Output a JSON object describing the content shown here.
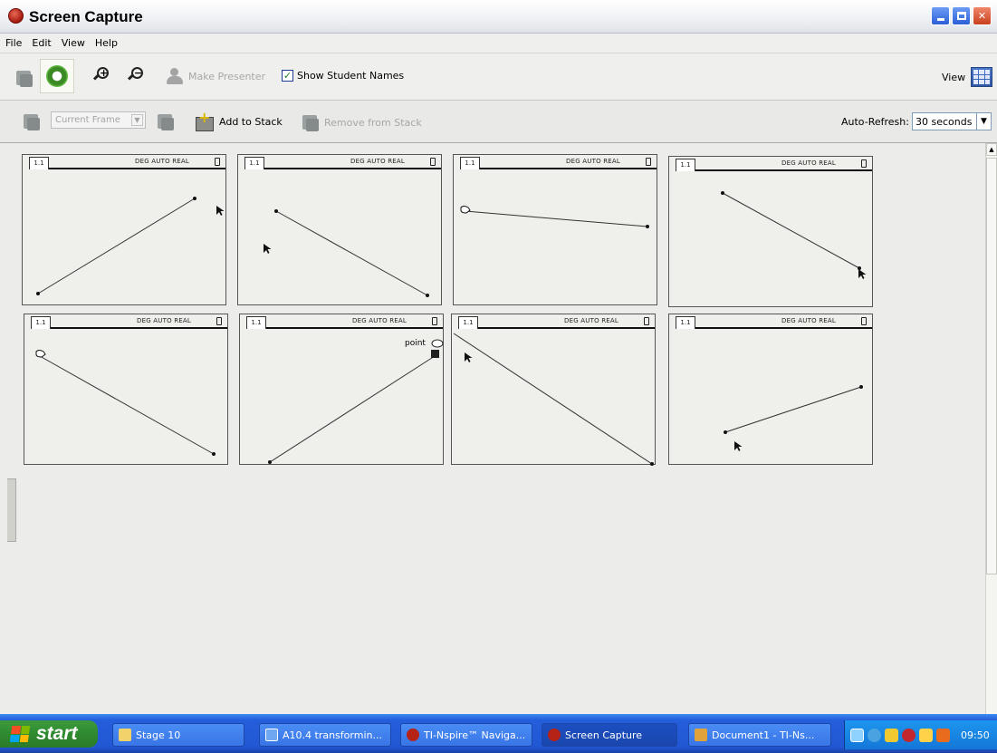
{
  "window": {
    "title": "Screen Capture"
  },
  "menu": [
    "File",
    "Edit",
    "View",
    "Help"
  ],
  "toolbar": {
    "make_presenter": "Make Presenter",
    "show_student_names": "Show Student Names",
    "show_student_names_checked": true,
    "view_label": "View"
  },
  "toolbar2": {
    "frame_select": "Current Frame",
    "add_to_stack": "Add to Stack",
    "remove_from_stack": "Remove from Stack",
    "auto_refresh_label": "Auto-Refresh:",
    "auto_refresh_value": "30 seconds"
  },
  "frames": [
    {
      "tab": "1.1",
      "mode": "DEG AUTO REAL"
    },
    {
      "tab": "1.1",
      "mode": "DEG AUTO REAL"
    },
    {
      "tab": "1.1",
      "mode": "DEG AUTO REAL"
    },
    {
      "tab": "1.1",
      "mode": "DEG AUTO REAL"
    },
    {
      "tab": "1.1",
      "mode": "DEG AUTO REAL"
    },
    {
      "tab": "1.1",
      "mode": "DEG AUTO REAL",
      "tooltip": "point"
    },
    {
      "tab": "1.1",
      "mode": "DEG AUTO REAL"
    },
    {
      "tab": "1.1",
      "mode": "DEG AUTO REAL"
    }
  ],
  "taskbar": {
    "start": "start",
    "tasks": [
      "Stage 10",
      "A10.4 transformin...",
      "TI-Nspire™ Naviga...",
      "Screen Capture",
      "Document1 - TI-Ns..."
    ],
    "clock": "09:50"
  },
  "colors": {
    "taskbar": "#245edb",
    "start": "#2f8a2f",
    "title_icon": "#a5170e"
  }
}
